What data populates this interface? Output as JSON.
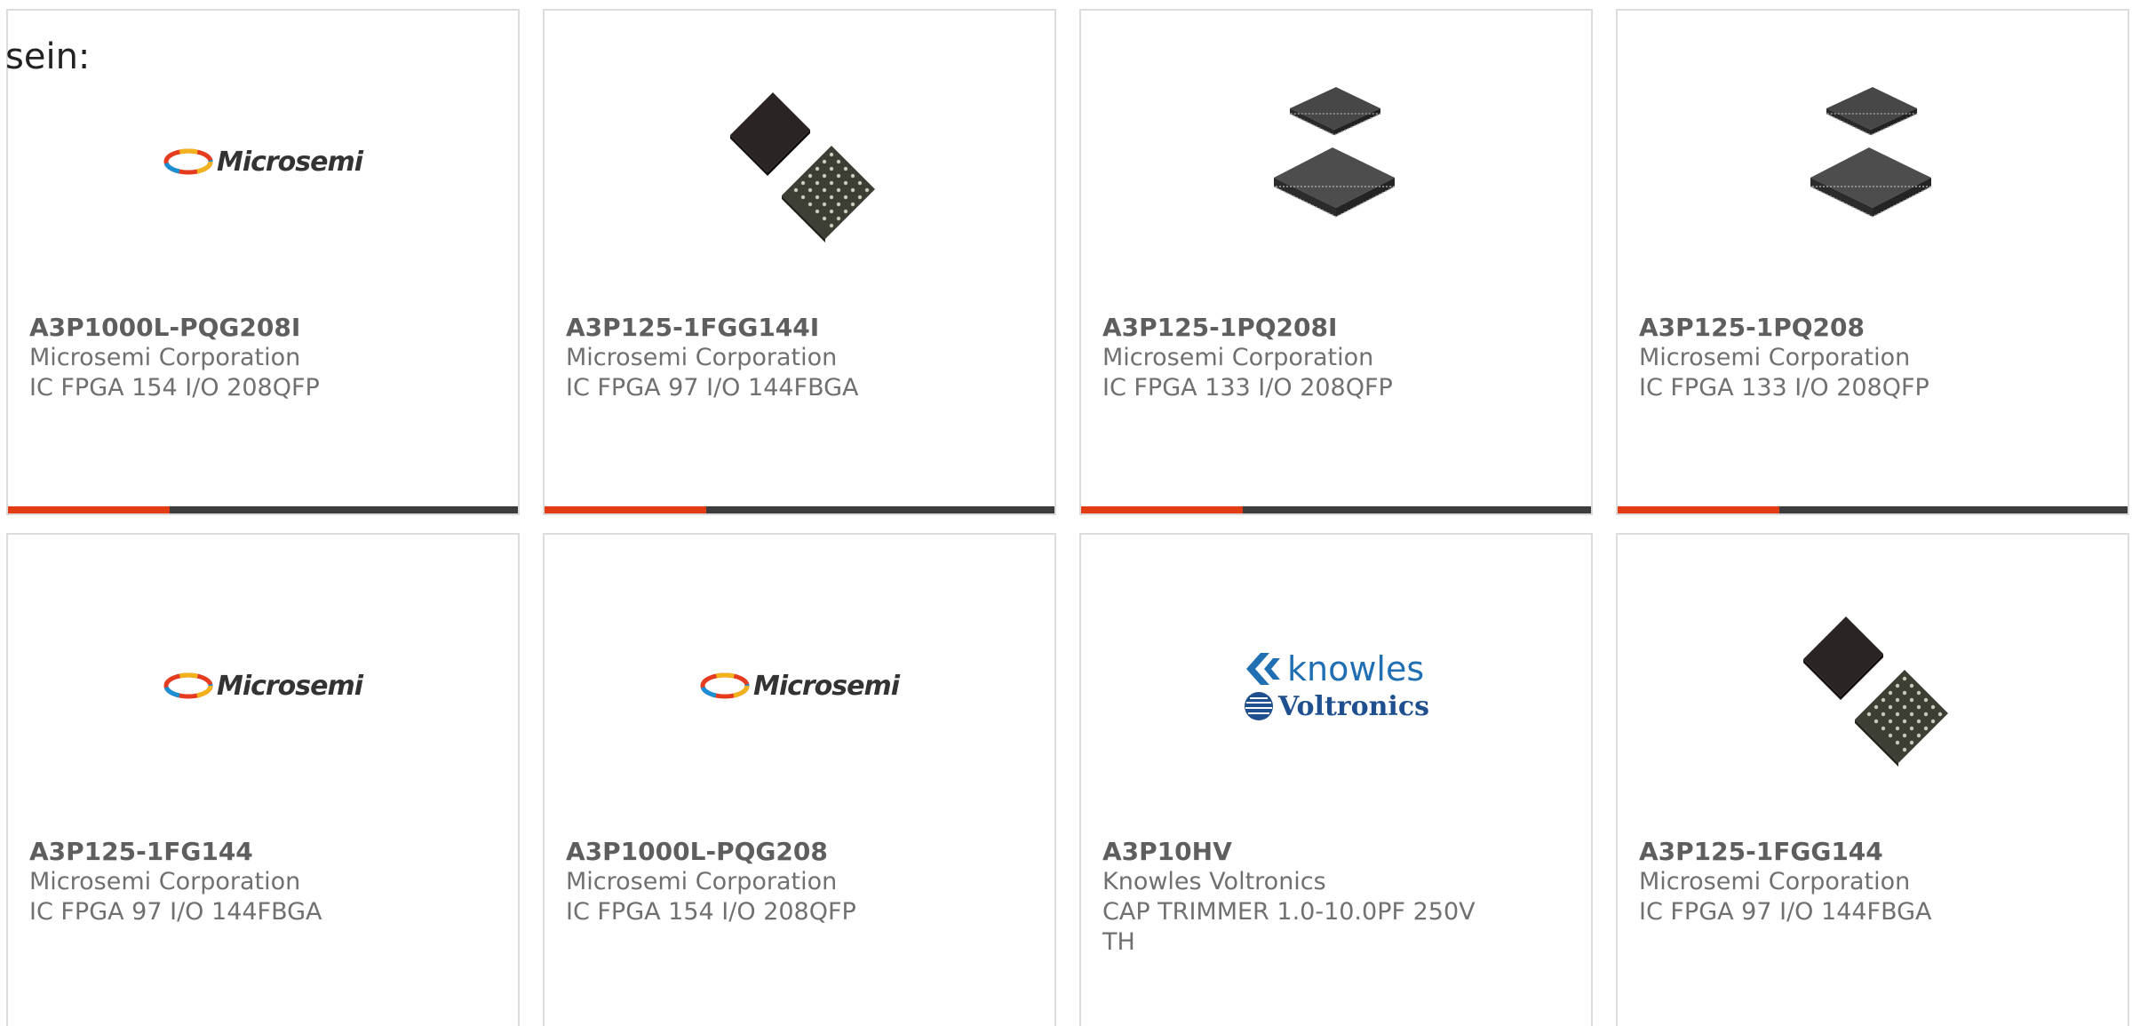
{
  "intro": "sein:",
  "products": [
    {
      "part": "A3P1000L-PQG208I",
      "manufacturer": "Microsemi Corporation",
      "description": "IC FPGA 154 I/O 208QFP",
      "image": "microsemi-logo"
    },
    {
      "part": "A3P125-1FGG144I",
      "manufacturer": "Microsemi Corporation",
      "description": "IC FPGA 97 I/O 144FBGA",
      "image": "bga-chip"
    },
    {
      "part": "A3P125-1PQ208I",
      "manufacturer": "Microsemi Corporation",
      "description": "IC FPGA 133 I/O 208QFP",
      "image": "qfp-chip"
    },
    {
      "part": "A3P125-1PQ208",
      "manufacturer": "Microsemi Corporation",
      "description": "IC FPGA 133 I/O 208QFP",
      "image": "qfp-chip"
    },
    {
      "part": "A3P125-1FG144",
      "manufacturer": "Microsemi Corporation",
      "description": "IC FPGA 97 I/O 144FBGA",
      "image": "microsemi-logo"
    },
    {
      "part": "A3P1000L-PQG208",
      "manufacturer": "Microsemi Corporation",
      "description": "IC FPGA 154 I/O 208QFP",
      "image": "microsemi-logo"
    },
    {
      "part": "A3P10HV",
      "manufacturer": "Knowles Voltronics",
      "description": "CAP TRIMMER 1.0-10.0PF 250V TH",
      "image": "knowles-voltronics-logo"
    },
    {
      "part": "A3P125-1FGG144",
      "manufacturer": "Microsemi Corporation",
      "description": "IC FPGA 97 I/O 144FBGA",
      "image": "bga-chip"
    }
  ],
  "logos": {
    "microsemi": "Microsemi",
    "knowles": "knowles",
    "voltronics": "Voltronics"
  },
  "colors": {
    "accent": "#e13c14",
    "bar": "#3c3c3c",
    "border": "#dcdcdc"
  }
}
